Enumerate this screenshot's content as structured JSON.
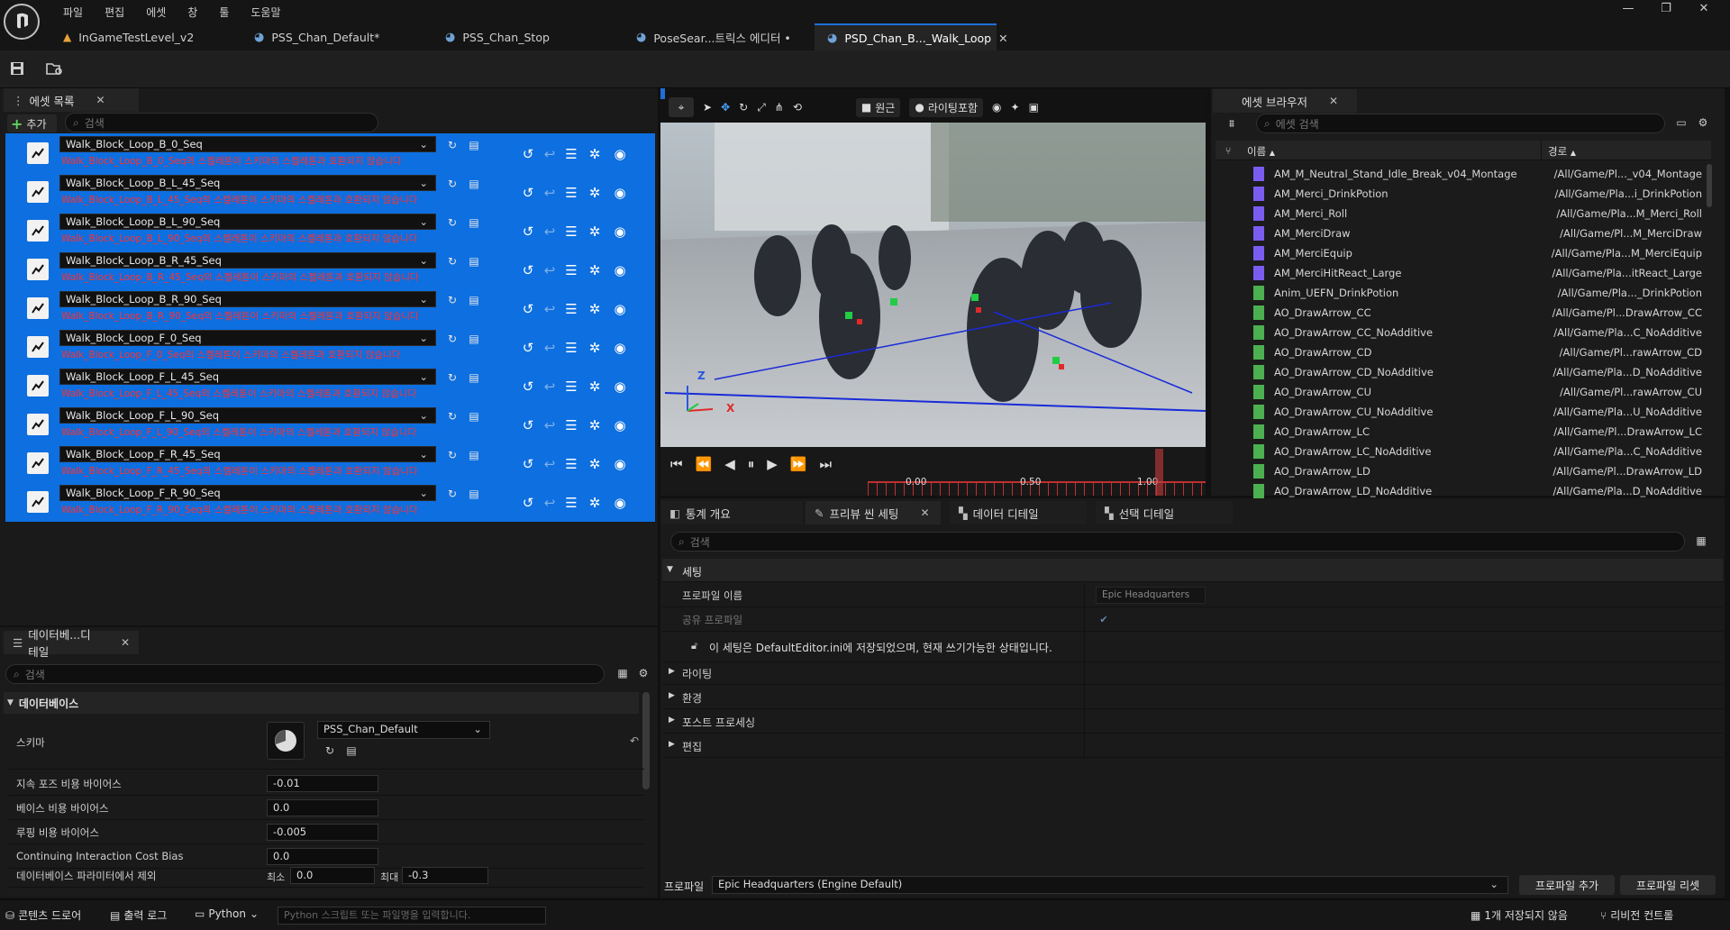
{
  "menu": [
    "파일",
    "편집",
    "에셋",
    "창",
    "툴",
    "도움말"
  ],
  "tabs": [
    {
      "label": "InGameTestLevel_v2"
    },
    {
      "label": "PSS_Chan_Default*"
    },
    {
      "label": "PSS_Chan_Stop"
    },
    {
      "label": "PoseSear...트릭스 에디터 •"
    },
    {
      "label": "PSD_Chan_B..._Walk_Loop"
    }
  ],
  "asset_panel": {
    "tab": "에셋 목록",
    "add_label": "추가",
    "search_placeholder": "검색"
  },
  "assets": [
    {
      "name": "Walk_Block_Loop_B_0_Seq",
      "warning": "Walk_Block_Loop_B_0_Seq의 스켈레톤이 스키마의 스켈레톤과 호환되지 않습니다"
    },
    {
      "name": "Walk_Block_Loop_B_L_45_Seq",
      "warning": "Walk_Block_Loop_B_L_45_Seq의 스켈레톤이 스키마의 스켈레톤과 호환되지 않습니다"
    },
    {
      "name": "Walk_Block_Loop_B_L_90_Seq",
      "warning": "Walk_Block_Loop_B_L_90_Seq의 스켈레톤이 스키마의 스켈레톤과 호환되지 않습니다"
    },
    {
      "name": "Walk_Block_Loop_B_R_45_Seq",
      "warning": "Walk_Block_Loop_B_R_45_Seq의 스켈레톤이 스키마의 스켈레톤과 호환되지 않습니다"
    },
    {
      "name": "Walk_Block_Loop_B_R_90_Seq",
      "warning": "Walk_Block_Loop_B_R_90_Seq의 스켈레톤이 스키마의 스켈레톤과 호환되지 않습니다"
    },
    {
      "name": "Walk_Block_Loop_F_0_Seq",
      "warning": "Walk_Block_Loop_F_0_Seq의 스켈레톤이 스키마의 스켈레톤과 호환되지 않습니다"
    },
    {
      "name": "Walk_Block_Loop_F_L_45_Seq",
      "warning": "Walk_Block_Loop_F_L_45_Seq의 스켈레톤이 스키마의 스켈레톤과 호환되지 않습니다"
    },
    {
      "name": "Walk_Block_Loop_F_L_90_Seq",
      "warning": "Walk_Block_Loop_F_L_90_Seq의 스켈레톤이 스키마의 스켈레톤과 호환되지 않습니다"
    },
    {
      "name": "Walk_Block_Loop_F_R_45_Seq",
      "warning": "Walk_Block_Loop_F_R_45_Seq의 스켈레톤이 스키마의 스켈레톤과 호환되지 않습니다"
    },
    {
      "name": "Walk_Block_Loop_F_R_90_Seq",
      "warning": "Walk_Block_Loop_F_R_90_Seq의 스켈레톤이 스키마의 스켈레톤과 호환되지 않습니다"
    }
  ],
  "details": {
    "tab": "데이터베...디테일",
    "search_placeholder": "검색",
    "section": "데이터베이스",
    "schema_label": "스키마",
    "schema_value": "PSS_Chan_Default",
    "rows": [
      {
        "label": "지속 포즈 비용 바이어스",
        "value": "-0.01"
      },
      {
        "label": "베이스 비용 바이어스",
        "value": "0.0"
      },
      {
        "label": "루핑 비용 바이어스",
        "value": "-0.005"
      },
      {
        "label": "Continuing Interaction Cost Bias",
        "value": "0.0"
      }
    ],
    "exclude_label": "데이터베이스 파라미터에서 제외",
    "min_label": "최소",
    "min_value": "0.0",
    "max_label": "최대",
    "max_value": "-0.3"
  },
  "viewport": {
    "perspective_label": "원근",
    "lighting_label": "라이팅포함",
    "axis_z": "Z",
    "axis_x": "X",
    "timeline_ticks": [
      "0.00",
      "0.50",
      "1.00"
    ]
  },
  "preview_tabs": [
    {
      "label": "통계 개요"
    },
    {
      "label": "프리뷰 씬 세팅"
    },
    {
      "label": "데이터 디테일"
    },
    {
      "label": "선택 디테일"
    }
  ],
  "preview_settings": {
    "search_placeholder": "검색",
    "section_settings": "세팅",
    "profile_name_label": "프로파일 이름",
    "profile_name_value": "Epic Headquarters",
    "shared_profile_label": "공유 프로파일",
    "note": "이 세팅은 DefaultEditor.ini에 저장되었으며, 현재 쓰기가능한 상태입니다.",
    "collapsed_sections": [
      "라이팅",
      "환경",
      "포스트 프로세싱",
      "편집"
    ],
    "profile_label": "프로파일",
    "profile_value": "Epic Headquarters (Engine Default)",
    "add_profile": "프로파일 추가",
    "reset_profile": "프로파일 리셋"
  },
  "browser": {
    "tab": "에셋 브라우저",
    "search_placeholder": "에셋 검색",
    "col_name": "이름",
    "col_path": "경로",
    "items": [
      {
        "name": "AM_M_Neutral_Stand_Idle_Break_v04_Montage",
        "path": "/All/Game/Pl..._v04_Montage",
        "color": "#7b5cf0"
      },
      {
        "name": "AM_Merci_DrinkPotion",
        "path": "/All/Game/Pla...i_DrinkPotion",
        "color": "#7b5cf0"
      },
      {
        "name": "AM_Merci_Roll",
        "path": "/All/Game/Pla...M_Merci_Roll",
        "color": "#7b5cf0"
      },
      {
        "name": "AM_MerciDraw",
        "path": "/All/Game/Pl...M_MerciDraw",
        "color": "#7b5cf0"
      },
      {
        "name": "AM_MerciEquip",
        "path": "/All/Game/Pla...M_MerciEquip",
        "color": "#7b5cf0"
      },
      {
        "name": "AM_MerciHitReact_Large",
        "path": "/All/Game/Pla...itReact_Large",
        "color": "#7b5cf0"
      },
      {
        "name": "Anim_UEFN_DrinkPotion",
        "path": "/All/Game/Pla..._DrinkPotion",
        "color": "#4caf50"
      },
      {
        "name": "AO_DrawArrow_CC",
        "path": "/All/Game/Pl...DrawArrow_CC",
        "color": "#4caf50"
      },
      {
        "name": "AO_DrawArrow_CC_NoAdditive",
        "path": "/All/Game/Pla...C_NoAdditive",
        "color": "#4caf50"
      },
      {
        "name": "AO_DrawArrow_CD",
        "path": "/All/Game/Pl...rawArrow_CD",
        "color": "#4caf50"
      },
      {
        "name": "AO_DrawArrow_CD_NoAdditive",
        "path": "/All/Game/Pla...D_NoAdditive",
        "color": "#4caf50"
      },
      {
        "name": "AO_DrawArrow_CU",
        "path": "/All/Game/Pl...rawArrow_CU",
        "color": "#4caf50"
      },
      {
        "name": "AO_DrawArrow_CU_NoAdditive",
        "path": "/All/Game/Pla...U_NoAdditive",
        "color": "#4caf50"
      },
      {
        "name": "AO_DrawArrow_LC",
        "path": "/All/Game/Pl...DrawArrow_LC",
        "color": "#4caf50"
      },
      {
        "name": "AO_DrawArrow_LC_NoAdditive",
        "path": "/All/Game/Pla...C_NoAdditive",
        "color": "#4caf50"
      },
      {
        "name": "AO_DrawArrow_LD",
        "path": "/All/Game/Pl...DrawArrow_LD",
        "color": "#4caf50"
      },
      {
        "name": "AO_DrawArrow_LD_NoAdditive",
        "path": "/All/Game/Pla...D_NoAdditive",
        "color": "#4caf50"
      }
    ]
  },
  "statusbar": {
    "content_drawer": "콘텐츠 드로어",
    "output_log": "출력 로그",
    "python": "Python",
    "python_placeholder": "Python 스크립트 또는 파일명을 입력합니다.",
    "unsaved": "1개 저장되지 않음",
    "revision": "리비전 컨트롤"
  }
}
